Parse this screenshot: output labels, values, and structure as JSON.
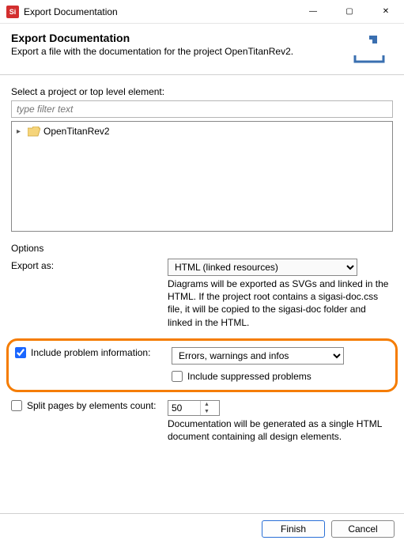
{
  "window": {
    "title": "Export Documentation",
    "minimize_glyph": "—",
    "maximize_glyph": "▢",
    "close_glyph": "✕"
  },
  "header": {
    "title": "Export Documentation",
    "subtitle": "Export a file with the documentation for the project OpenTitanRev2."
  },
  "project_picker": {
    "label": "Select a project or top level element:",
    "filter_placeholder": "type filter text",
    "tree": {
      "items": [
        {
          "label": "OpenTitanRev2"
        }
      ]
    }
  },
  "options": {
    "label": "Options",
    "export_as": {
      "label": "Export as:",
      "selected": "HTML (linked resources)",
      "hint": "Diagrams will be exported as SVGs and linked in the HTML. If the project root contains a sigasi-doc.css file, it will be copied to the sigasi-doc folder and linked in the HTML."
    },
    "include_problem_info": {
      "label": "Include problem information:",
      "checked": true,
      "dropdown_selected": "Errors, warnings and infos",
      "suppressed_label": "Include suppressed problems",
      "suppressed_checked": false
    },
    "split_pages": {
      "label": "Split pages by elements count:",
      "checked": false,
      "value": "50",
      "hint": "Documentation will be generated as a single HTML document containing all design elements."
    }
  },
  "buttons": {
    "finish": "Finish",
    "cancel": "Cancel"
  }
}
